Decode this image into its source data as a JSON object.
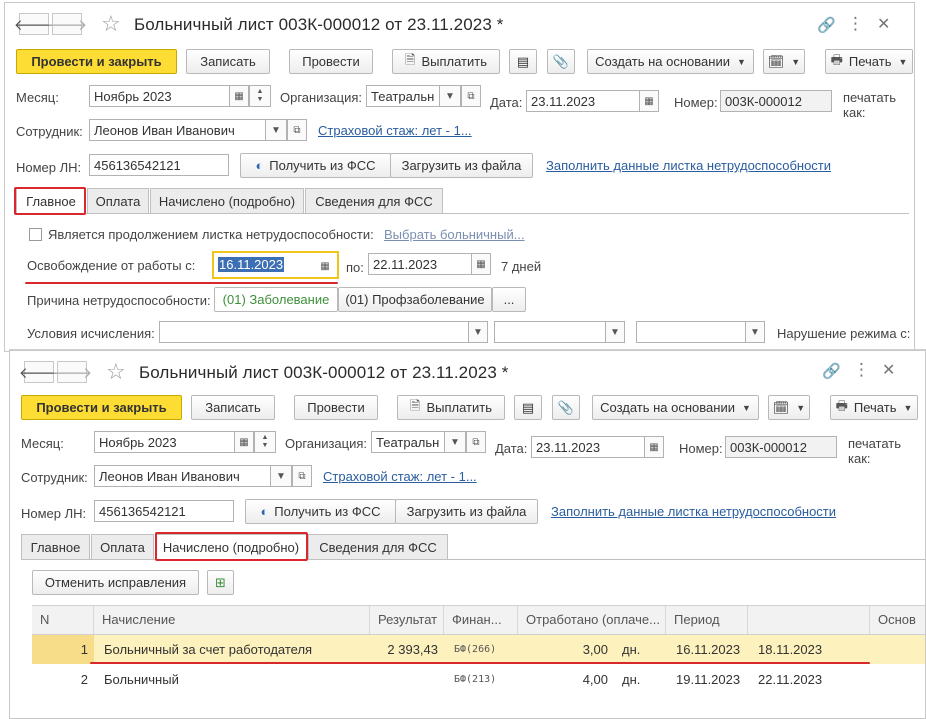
{
  "window": {
    "title": "Больничный лист 003К-000012 от 23.11.2023 *"
  },
  "toolbar": {
    "post_and_close": "Провести и закрыть",
    "save": "Записать",
    "post": "Провести",
    "pay": "Выплатить",
    "create_based_on": "Создать на основании",
    "print": "Печать"
  },
  "header": {
    "month_label": "Месяц:",
    "month_value": "Ноябрь 2023",
    "org_label": "Организация:",
    "org_value": "Театральн",
    "date_label": "Дата:",
    "date_value": "23.11.2023",
    "number_label": "Номер:",
    "number_value": "003К-000012",
    "print_as_label": "печатать как:",
    "employee_label": "Сотрудник:",
    "employee_value": "Леонов Иван Иванович",
    "insurance_link": "Страховой стаж: лет - 1...",
    "ln_label": "Номер ЛН:",
    "ln_value": "456136542121",
    "get_from_fss": "Получить из ФСС",
    "load_from_file": "Загрузить из файла",
    "fill_link": "Заполнить данные листка нетрудоспособности"
  },
  "tabs": {
    "main": "Главное",
    "payment": "Оплата",
    "accrued": "Начислено (подробно)",
    "fss": "Сведения для ФСС"
  },
  "main_tab": {
    "continuation_label": "Является продолжением листка нетрудоспособности:",
    "choose_sick_link": "Выбрать больничный...",
    "release_label": "Освобождение от работы с:",
    "release_from": "16.11.2023",
    "to_label": "по:",
    "release_to": "22.11.2023",
    "days_text": "7 дней",
    "reason_label": "Причина нетрудоспособности:",
    "reason_disease": "(01) Заболевание",
    "reason_occupational": "(01) Профзаболевание",
    "reason_more": "...",
    "calc_conditions_label": "Условия исчисления:",
    "regime_violation_label": "Нарушение режима с:"
  },
  "accrued_tab": {
    "cancel_corrections": "Отменить исправления",
    "columns": [
      "N",
      "Начисление",
      "Результат",
      "Финан...",
      "Отработано (оплаче...",
      "Период",
      "",
      "Основ"
    ],
    "rows": [
      {
        "n": "1",
        "accrual": "Больничный за счет работодателя",
        "result": "2 393,43",
        "finance": "БФ(266)",
        "worked": "3,00",
        "unit": "дн.",
        "from": "16.11.2023",
        "to": "18.11.2023"
      },
      {
        "n": "2",
        "accrual": "Больничный",
        "result": "",
        "finance": "БФ(213)",
        "worked": "4,00",
        "unit": "дн.",
        "from": "19.11.2023",
        "to": "22.11.2023"
      }
    ]
  },
  "colors": {
    "primary_button": "#fddc34",
    "highlight_red": "#d9272e",
    "link_blue": "#2a5d9f",
    "selected_row": "#fdf1bd"
  }
}
